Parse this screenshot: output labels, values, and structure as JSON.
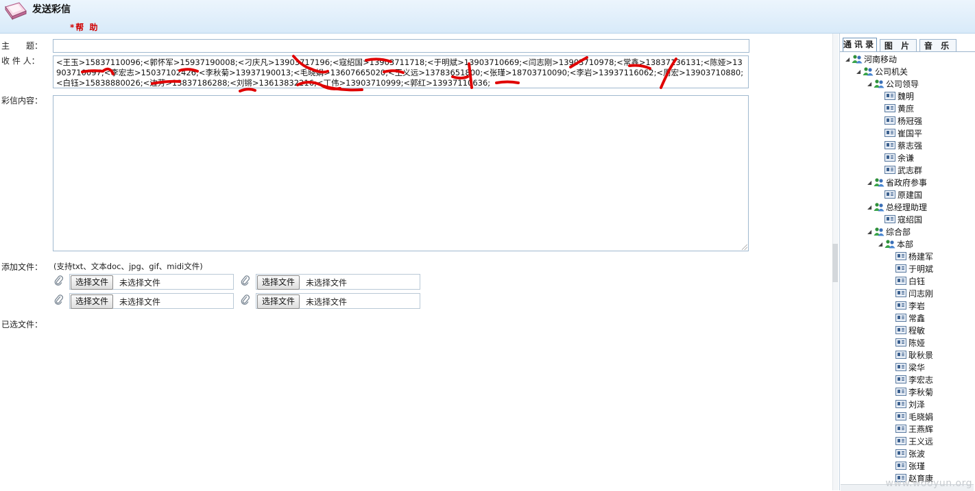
{
  "header": {
    "title": "发送彩信",
    "help": "*帮 助"
  },
  "form": {
    "subject_label": "主　　题：",
    "subject_value": "",
    "recipients_label": "收 件 人：",
    "recipients_value": "<王玉>15837110096;<郭怀军>15937190008;<刁庆凡>13903717196;<寇绍国>13903711718;<于明斌>13903710669;<闫志刚>13903710978;<常鑫>13837136131;<陈娅>13903710097;<李宏志>15037102426;<李秋菊>13937190013;<毛晓娟>13607665020;<王义远>13783651800;<张瑾>18703710090;<李岩>13937116062;<周宏>13903710880;<白钰>15838880026;<边芳>13837186288;<刘锵>13613832216;<丁伟>13903710999;<郭红>13937110636;",
    "content_label": "彩信内容：",
    "attach_label": "添加文件：",
    "attach_note": "(支持txt、文本doc、jpg、gif、midi文件)",
    "choose_button": "选择文件",
    "no_file": "未选择文件",
    "selected_label": "已选文件："
  },
  "panel": {
    "tabs": [
      "通讯录",
      "图 片",
      "音 乐"
    ],
    "active_tab": 0,
    "tree": [
      {
        "label": "河南移动",
        "kind": "group",
        "level": 0
      },
      {
        "label": "公司机关",
        "kind": "group",
        "level": 1
      },
      {
        "label": "公司领导",
        "kind": "group",
        "level": 2
      },
      {
        "label": "魏明",
        "kind": "contact",
        "level": 3
      },
      {
        "label": "黄庶",
        "kind": "contact",
        "level": 3
      },
      {
        "label": "杨冠强",
        "kind": "contact",
        "level": 3
      },
      {
        "label": "崔国平",
        "kind": "contact",
        "level": 3
      },
      {
        "label": "蔡志强",
        "kind": "contact",
        "level": 3
      },
      {
        "label": "余谦",
        "kind": "contact",
        "level": 3
      },
      {
        "label": "武志群",
        "kind": "contact",
        "level": 3
      },
      {
        "label": "省政府参事",
        "kind": "group",
        "level": 2
      },
      {
        "label": "原建国",
        "kind": "contact",
        "level": 3
      },
      {
        "label": "总经理助理",
        "kind": "group",
        "level": 2
      },
      {
        "label": "寇绍国",
        "kind": "contact",
        "level": 3
      },
      {
        "label": "综合部",
        "kind": "group",
        "level": 2
      },
      {
        "label": "本部",
        "kind": "group",
        "level": 3
      },
      {
        "label": "杨建军",
        "kind": "contact",
        "level": 4
      },
      {
        "label": "于明斌",
        "kind": "contact",
        "level": 4
      },
      {
        "label": "白钰",
        "kind": "contact",
        "level": 4
      },
      {
        "label": "闫志刚",
        "kind": "contact",
        "level": 4
      },
      {
        "label": "李岩",
        "kind": "contact",
        "level": 4
      },
      {
        "label": "常鑫",
        "kind": "contact",
        "level": 4
      },
      {
        "label": "程敏",
        "kind": "contact",
        "level": 4
      },
      {
        "label": "陈娅",
        "kind": "contact",
        "level": 4
      },
      {
        "label": "耿秋景",
        "kind": "contact",
        "level": 4
      },
      {
        "label": "梁华",
        "kind": "contact",
        "level": 4
      },
      {
        "label": "李宏志",
        "kind": "contact",
        "level": 4
      },
      {
        "label": "李秋菊",
        "kind": "contact",
        "level": 4
      },
      {
        "label": "刘泽",
        "kind": "contact",
        "level": 4
      },
      {
        "label": "毛晓娟",
        "kind": "contact",
        "level": 4
      },
      {
        "label": "王燕辉",
        "kind": "contact",
        "level": 4
      },
      {
        "label": "王义远",
        "kind": "contact",
        "level": 4
      },
      {
        "label": "张波",
        "kind": "contact",
        "level": 4
      },
      {
        "label": "张瑾",
        "kind": "contact",
        "level": 4
      },
      {
        "label": "赵育康",
        "kind": "contact",
        "level": 4
      }
    ]
  },
  "watermark": "www.wooyun.org",
  "colors": {
    "help": "#d00000",
    "header_bg": "#ecf5fd",
    "input_border": "#9fb8cf",
    "redaction": "#e00000"
  }
}
